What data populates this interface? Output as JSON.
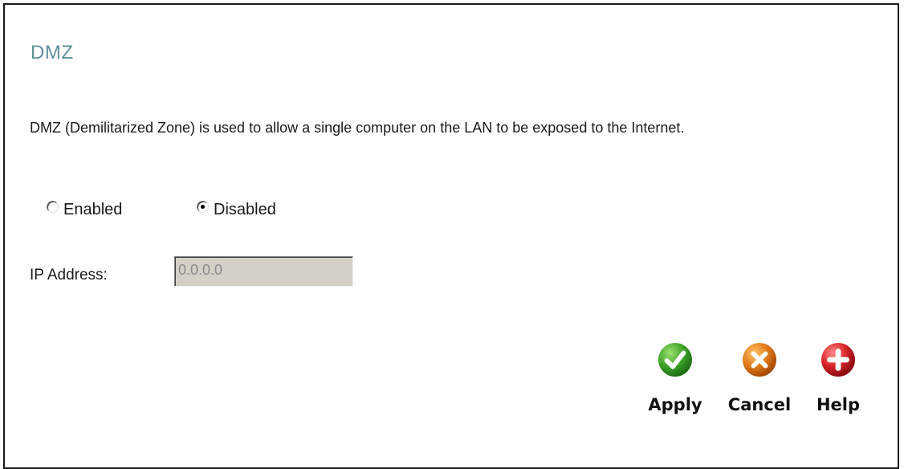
{
  "page": {
    "title": "DMZ",
    "description": "DMZ (Demilitarized Zone) is used to allow a single computer on the LAN to be exposed to the Internet."
  },
  "mode": {
    "options": [
      {
        "label": "Enabled",
        "checked": false
      },
      {
        "label": "Disabled",
        "checked": true
      }
    ]
  },
  "ip": {
    "label": "IP Address:",
    "value": "0.0.0.0",
    "disabled": true
  },
  "buttons": {
    "apply": {
      "label": "Apply",
      "icon": "checkmark-icon",
      "color": "#3a9c2a"
    },
    "cancel": {
      "label": "Cancel",
      "icon": "x-icon",
      "color": "#e07a1a"
    },
    "help": {
      "label": "Help",
      "icon": "plus-icon",
      "color": "#d8262a"
    }
  },
  "colors": {
    "title": "#5f8f98",
    "input_disabled_bg": "#d4d0c8"
  }
}
